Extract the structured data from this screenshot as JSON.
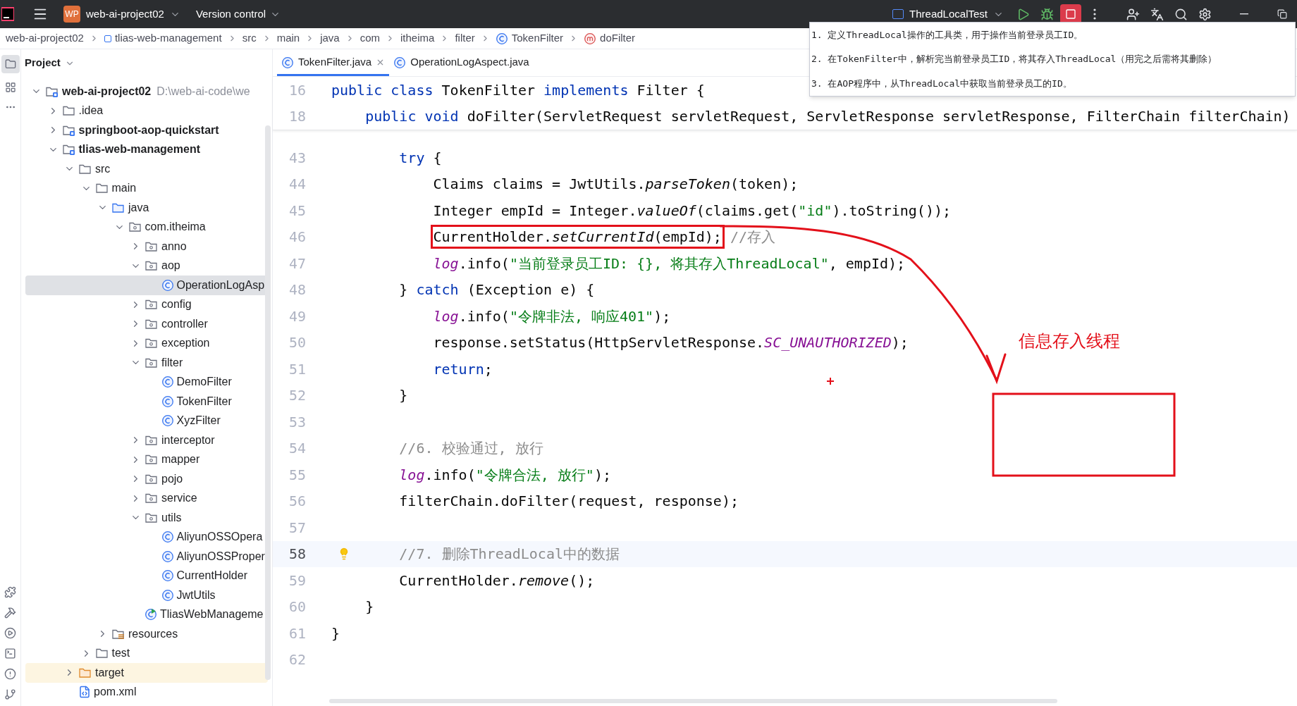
{
  "title_bar": {
    "project_badge": "WP",
    "project": "web-ai-project02",
    "vcs": "Version control",
    "run_config": "ThreadLocalTest"
  },
  "breadcrumbs": [
    {
      "label": "web-ai-project02",
      "kind": "plain"
    },
    {
      "label": "tlias-web-management",
      "kind": "module"
    },
    {
      "label": "src",
      "kind": "plain"
    },
    {
      "label": "main",
      "kind": "plain"
    },
    {
      "label": "java",
      "kind": "plain"
    },
    {
      "label": "com",
      "kind": "plain"
    },
    {
      "label": "itheima",
      "kind": "plain"
    },
    {
      "label": "filter",
      "kind": "plain"
    },
    {
      "label": "TokenFilter",
      "kind": "class"
    },
    {
      "label": "doFilter",
      "kind": "method"
    }
  ],
  "tooltip": {
    "lines": [
      "1. 定义ThreadLocal操作的工具类，用于操作当前登录员工ID。",
      "2. 在TokenFilter中，解析完当前登录员工ID，将其存入ThreadLocal（用完之后需将其删除）",
      "3. 在AOP程序中，从ThreadLocal中获取当前登录员工的ID。"
    ]
  },
  "project_panel": {
    "title": "Project",
    "tree": [
      {
        "label": "web-ai-project02",
        "hint": "D:\\web-ai-code\\we",
        "kind": "module",
        "expanded": true,
        "selected": false,
        "children": [
          {
            "label": ".idea",
            "kind": "folder",
            "expanded": false,
            "selected": false
          },
          {
            "label": "springboot-aop-quickstart",
            "kind": "module",
            "expanded": false,
            "selected": false
          },
          {
            "label": "tlias-web-management",
            "kind": "module",
            "expanded": true,
            "selected": false,
            "children": [
              {
                "label": "src",
                "kind": "folder",
                "expanded": true,
                "selected": false,
                "children": [
                  {
                    "label": "main",
                    "kind": "folder",
                    "expanded": true,
                    "selected": false,
                    "children": [
                      {
                        "label": "java",
                        "kind": "source",
                        "expanded": true,
                        "selected": false,
                        "children": [
                          {
                            "label": "com.itheima",
                            "kind": "package",
                            "expanded": true,
                            "selected": false,
                            "children": [
                              {
                                "label": "anno",
                                "kind": "package",
                                "expanded": false,
                                "selected": false
                              },
                              {
                                "label": "aop",
                                "kind": "package",
                                "expanded": true,
                                "selected": false,
                                "children": [
                                  {
                                    "label": "OperationLogAsp",
                                    "kind": "class",
                                    "selected": true
                                  }
                                ]
                              },
                              {
                                "label": "config",
                                "kind": "package",
                                "expanded": false,
                                "selected": false
                              },
                              {
                                "label": "controller",
                                "kind": "package",
                                "expanded": false,
                                "selected": false
                              },
                              {
                                "label": "exception",
                                "kind": "package",
                                "expanded": false,
                                "selected": false
                              },
                              {
                                "label": "filter",
                                "kind": "package",
                                "expanded": true,
                                "selected": false,
                                "children": [
                                  {
                                    "label": "DemoFilter",
                                    "kind": "class",
                                    "selected": false
                                  },
                                  {
                                    "label": "TokenFilter",
                                    "kind": "class",
                                    "selected": false
                                  },
                                  {
                                    "label": "XyzFilter",
                                    "kind": "class",
                                    "selected": false
                                  }
                                ]
                              },
                              {
                                "label": "interceptor",
                                "kind": "package",
                                "expanded": false,
                                "selected": false
                              },
                              {
                                "label": "mapper",
                                "kind": "package",
                                "expanded": false,
                                "selected": false
                              },
                              {
                                "label": "pojo",
                                "kind": "package",
                                "expanded": false,
                                "selected": false
                              },
                              {
                                "label": "service",
                                "kind": "package",
                                "expanded": false,
                                "selected": false
                              },
                              {
                                "label": "utils",
                                "kind": "package",
                                "expanded": true,
                                "selected": false,
                                "children": [
                                  {
                                    "label": "AliyunOSSOpera",
                                    "kind": "class",
                                    "selected": false
                                  },
                                  {
                                    "label": "AliyunOSSProper",
                                    "kind": "class",
                                    "selected": false
                                  },
                                  {
                                    "label": "CurrentHolder",
                                    "kind": "class",
                                    "selected": false
                                  },
                                  {
                                    "label": "JwtUtils",
                                    "kind": "class",
                                    "selected": false
                                  }
                                ]
                              },
                              {
                                "label": "TliasWebManageme",
                                "kind": "app",
                                "selected": false
                              }
                            ]
                          }
                        ]
                      },
                      {
                        "label": "resources",
                        "kind": "resources",
                        "expanded": false,
                        "selected": false
                      }
                    ]
                  },
                  {
                    "label": "test",
                    "kind": "folder",
                    "expanded": false,
                    "selected": false
                  }
                ]
              },
              {
                "label": "target",
                "kind": "excluded",
                "expanded": false,
                "selected": false
              },
              {
                "label": "pom.xml",
                "kind": "maven",
                "selected": false
              }
            ]
          }
        ]
      }
    ]
  },
  "tabs": [
    {
      "label": "TokenFilter.java",
      "selected": true
    },
    {
      "label": "OperationLogAspect.java",
      "selected": false
    }
  ],
  "sticky_lines": [
    {
      "number": "16",
      "tokens": [
        {
          "kind": "keyword",
          "text": "public class "
        },
        {
          "kind": "plain",
          "text": "TokenFilter "
        },
        {
          "kind": "keyword",
          "text": "implements "
        },
        {
          "kind": "plain",
          "text": "Filter {"
        }
      ]
    },
    {
      "number": "18",
      "tokens": [
        {
          "kind": "keyword",
          "text": "    public void "
        },
        {
          "kind": "plain",
          "text": "doFilter(ServletRequest servletRequest, ServletResponse servletResponse, FilterChain filterChain)"
        }
      ]
    }
  ],
  "lines": [
    {
      "number": "43",
      "current": false,
      "tokens": [
        {
          "kind": "keyword",
          "text": "        try"
        },
        {
          "kind": "plain",
          "text": " {"
        }
      ]
    },
    {
      "number": "44",
      "current": false,
      "tokens": [
        {
          "kind": "plain",
          "text": "            Claims claims = JwtUtils."
        },
        {
          "kind": "italic",
          "text": "parseToken"
        },
        {
          "kind": "plain",
          "text": "(token);"
        }
      ]
    },
    {
      "number": "45",
      "current": false,
      "tokens": [
        {
          "kind": "plain",
          "text": "            Integer empId = Integer."
        },
        {
          "kind": "italic",
          "text": "valueOf"
        },
        {
          "kind": "plain",
          "text": "(claims.get("
        },
        {
          "kind": "string",
          "text": "\"id\""
        },
        {
          "kind": "plain",
          "text": ").toString());"
        }
      ]
    },
    {
      "number": "46",
      "current": false,
      "tokens": [
        {
          "kind": "plain",
          "text": "            CurrentHolder.",
          "boxed": true
        },
        {
          "kind": "italic",
          "text": "setCurrentId",
          "boxed": true
        },
        {
          "kind": "plain",
          "text": "(empId);",
          "boxed": true
        },
        {
          "kind": "comment",
          "text": " //存入",
          "boxed": false
        }
      ]
    },
    {
      "number": "47",
      "current": false,
      "tokens": [
        {
          "kind": "field",
          "text": "            log"
        },
        {
          "kind": "plain",
          "text": ".info("
        },
        {
          "kind": "string",
          "text": "\"当前登录员工ID: {}, 将其存入ThreadLocal\""
        },
        {
          "kind": "plain",
          "text": ", empId);"
        }
      ]
    },
    {
      "number": "48",
      "current": false,
      "tokens": [
        {
          "kind": "plain",
          "text": "        } "
        },
        {
          "kind": "keyword",
          "text": "catch"
        },
        {
          "kind": "plain",
          "text": " (Exception e) {"
        }
      ]
    },
    {
      "number": "49",
      "current": false,
      "tokens": [
        {
          "kind": "field",
          "text": "            log"
        },
        {
          "kind": "plain",
          "text": ".info("
        },
        {
          "kind": "string",
          "text": "\"令牌非法, 响应401\""
        },
        {
          "kind": "plain",
          "text": ");"
        }
      ]
    },
    {
      "number": "50",
      "current": false,
      "tokens": [
        {
          "kind": "plain",
          "text": "            response.setStatus(HttpServletResponse."
        },
        {
          "kind": "field",
          "text": "SC_UNAUTHORIZED"
        },
        {
          "kind": "plain",
          "text": ");"
        }
      ]
    },
    {
      "number": "51",
      "current": false,
      "tokens": [
        {
          "kind": "keyword",
          "text": "            return"
        },
        {
          "kind": "plain",
          "text": ";"
        }
      ]
    },
    {
      "number": "52",
      "current": false,
      "tokens": [
        {
          "kind": "plain",
          "text": "        }"
        }
      ]
    },
    {
      "number": "53",
      "current": false
    },
    {
      "number": "54",
      "current": false,
      "tokens": [
        {
          "kind": "comment",
          "text": "        //6. 校验通过, 放行"
        }
      ]
    },
    {
      "number": "55",
      "current": false,
      "tokens": [
        {
          "kind": "field",
          "text": "        log"
        },
        {
          "kind": "plain",
          "text": ".info("
        },
        {
          "kind": "string",
          "text": "\"令牌合法, 放行\""
        },
        {
          "kind": "plain",
          "text": ");"
        }
      ]
    },
    {
      "number": "56",
      "current": false,
      "tokens": [
        {
          "kind": "plain",
          "text": "        filterChain.doFilter(request, response);"
        }
      ]
    },
    {
      "number": "57",
      "current": false
    },
    {
      "number": "58",
      "current": true,
      "bulb": true,
      "tokens": [
        {
          "kind": "comment",
          "text": "        //7. 删除ThreadLocal中的数据"
        }
      ]
    },
    {
      "number": "59",
      "current": false,
      "tokens": [
        {
          "kind": "plain",
          "text": "        CurrentHolder."
        },
        {
          "kind": "italic",
          "text": "remove"
        },
        {
          "kind": "plain",
          "text": "();"
        }
      ]
    },
    {
      "number": "60",
      "current": false,
      "tokens": [
        {
          "kind": "plain",
          "text": "    }"
        }
      ]
    },
    {
      "number": "61",
      "current": false,
      "tokens": [
        {
          "kind": "plain",
          "text": "}"
        }
      ]
    },
    {
      "number": "62",
      "current": false
    }
  ],
  "annotation": {
    "label": "信息存入线程"
  }
}
